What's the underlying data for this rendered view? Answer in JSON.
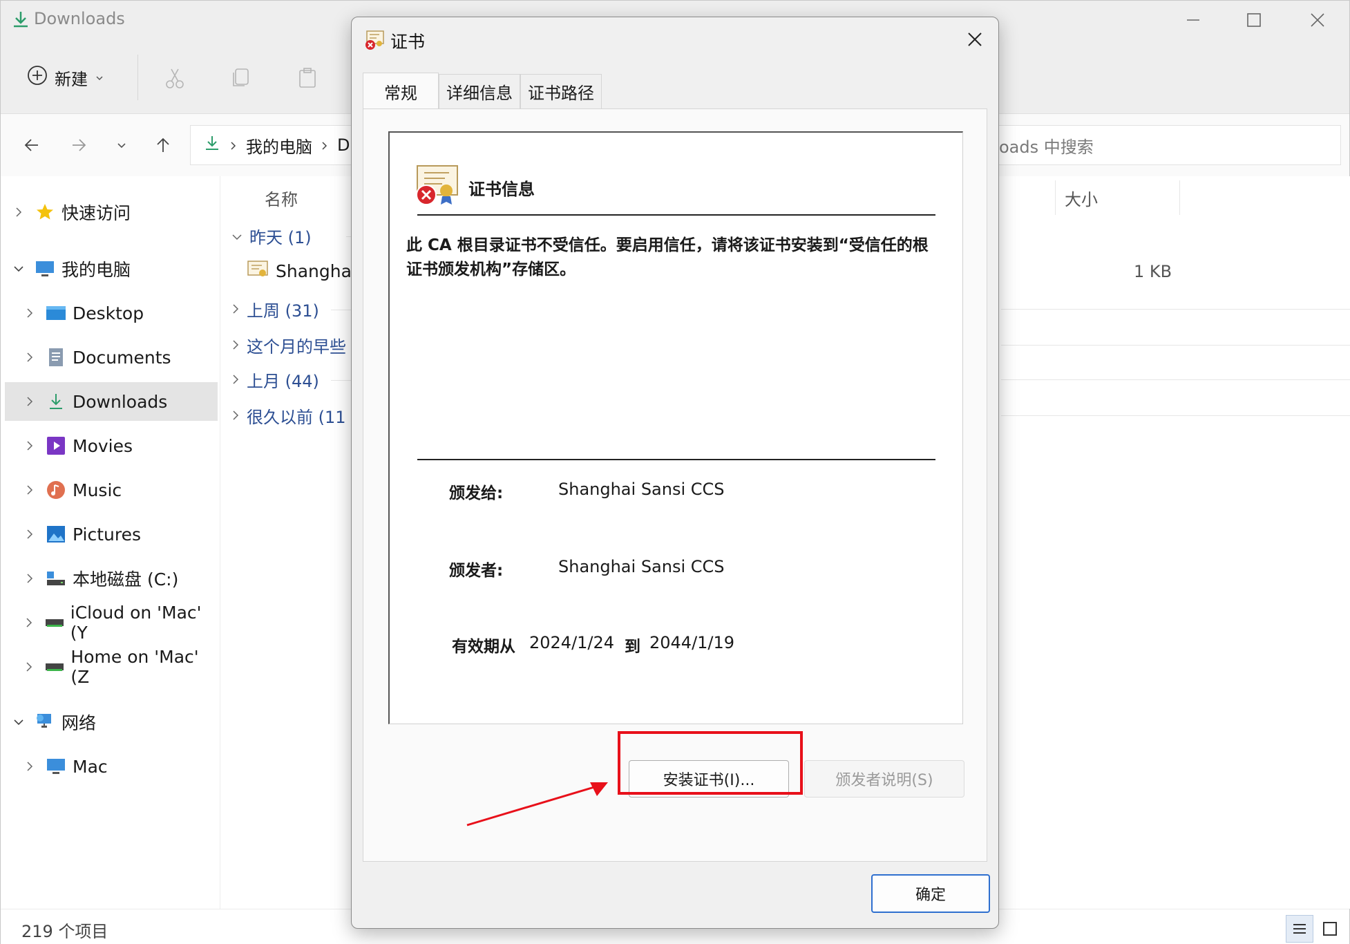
{
  "explorer": {
    "title": "Downloads",
    "toolbar": {
      "new_label": "新建"
    },
    "breadcrumb": {
      "root": "我的电脑",
      "current_partial": "D"
    },
    "search": {
      "placeholder": "oads 中搜索"
    },
    "columns": {
      "name": "名称",
      "size": "大小"
    },
    "groups": [
      {
        "label": "昨天 (1)",
        "expanded": true
      },
      {
        "label": "上周 (31)",
        "expanded": false
      },
      {
        "label": "这个月的早些",
        "expanded": false
      },
      {
        "label": "上月 (44)",
        "expanded": false
      },
      {
        "label": "很久以前 (11",
        "expanded": false
      }
    ],
    "file": {
      "name": "Shanghai",
      "size": "1 KB"
    },
    "sidebar": {
      "items": [
        {
          "label": "快速访问",
          "icon": "star-icon"
        },
        {
          "label": "我的电脑",
          "icon": "monitor-icon"
        },
        {
          "label": "Desktop",
          "icon": "desktop-folder-icon"
        },
        {
          "label": "Documents",
          "icon": "documents-icon"
        },
        {
          "label": "Downloads",
          "icon": "download-icon"
        },
        {
          "label": "Movies",
          "icon": "movies-icon"
        },
        {
          "label": "Music",
          "icon": "music-icon"
        },
        {
          "label": "Pictures",
          "icon": "pictures-icon"
        },
        {
          "label": "本地磁盘 (C:)",
          "icon": "drive-icon"
        },
        {
          "label": "iCloud on 'Mac' (Y",
          "icon": "network-drive-icon"
        },
        {
          "label": "Home on 'Mac' (Z",
          "icon": "network-drive-icon"
        },
        {
          "label": "网络",
          "icon": "network-icon"
        },
        {
          "label": "Mac",
          "icon": "monitor-icon"
        }
      ]
    },
    "status": {
      "count": "219 个项目"
    }
  },
  "dialog": {
    "title": "证书",
    "tabs": [
      "常规",
      "详细信息",
      "证书路径"
    ],
    "cert_info_title": "证书信息",
    "warning": "此 CA 根目录证书不受信任。要启用信任，请将该证书安装到“受信任的根证书颁发机构”存储区。",
    "issued_to_label": "颁发给:",
    "issued_to": "Shanghai Sansi CCS",
    "issued_by_label": "颁发者:",
    "issued_by": "Shanghai Sansi CCS",
    "valid_from_label": "有效期从",
    "valid_from": "2024/1/24",
    "valid_to_label": "到",
    "valid_to": "2044/1/19",
    "install_button": "安装证书(I)...",
    "issuer_statement_button": "颁发者说明(S)",
    "ok_button": "确定"
  },
  "colors": {
    "highlight": "#e8101a",
    "link_blue": "#2d4f93",
    "ok_border": "#2e6fcf"
  }
}
